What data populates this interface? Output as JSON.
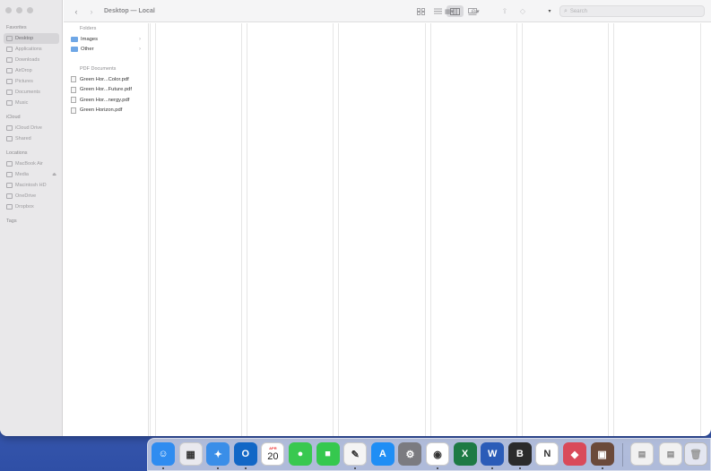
{
  "window": {
    "title": "Desktop — Local",
    "search_placeholder": "Search"
  },
  "sidebar": {
    "favorites_header": "Favorites",
    "favorites": [
      {
        "label": "Desktop",
        "icon": "desktop-icon",
        "active": true
      },
      {
        "label": "Applications",
        "icon": "applications-icon"
      },
      {
        "label": "Downloads",
        "icon": "downloads-icon"
      },
      {
        "label": "AirDrop",
        "icon": "airdrop-icon"
      },
      {
        "label": "Pictures",
        "icon": "pictures-icon"
      },
      {
        "label": "Documents",
        "icon": "documents-icon"
      },
      {
        "label": "Music",
        "icon": "music-icon"
      }
    ],
    "icloud_header": "iCloud",
    "icloud": [
      {
        "label": "iCloud Drive",
        "icon": "cloud-icon"
      },
      {
        "label": "Shared",
        "icon": "shared-folder-icon"
      }
    ],
    "locations_header": "Locations",
    "locations": [
      {
        "label": "MacBook Air",
        "icon": "laptop-icon"
      },
      {
        "label": "Media",
        "icon": "disk-icon",
        "eject": true
      },
      {
        "label": "Macintosh HD",
        "icon": "disk-icon"
      },
      {
        "label": "OneDrive",
        "icon": "folder-icon"
      },
      {
        "label": "Dropbox",
        "icon": "folder-icon"
      }
    ],
    "tags_header": "Tags"
  },
  "column1": {
    "folders_header": "Folders",
    "folders": [
      "Images",
      "Other"
    ],
    "pdf_header": "PDF Documents",
    "pdfs": [
      "Green Hor...Color.pdf",
      "Green Hor...Future.pdf",
      "Green Hor...nergy.pdf",
      "Green Horizon.pdf"
    ]
  },
  "dock": {
    "calendar_month": "APR",
    "calendar_day": "20",
    "apps": [
      {
        "name": "finder",
        "color": "#2f8cf0",
        "glyph": "☺",
        "running": true
      },
      {
        "name": "launchpad",
        "color": "#e9e9ee",
        "glyph": "▦",
        "running": false
      },
      {
        "name": "safari",
        "color": "#3a8ee8",
        "glyph": "✦",
        "running": true
      },
      {
        "name": "outlook",
        "color": "#1267c6",
        "glyph": "O",
        "running": true
      },
      {
        "name": "calendar",
        "color": "#ffffff",
        "glyph": "",
        "running": false
      },
      {
        "name": "messages",
        "color": "#39c850",
        "glyph": "●",
        "running": false
      },
      {
        "name": "facetime",
        "color": "#35c84e",
        "glyph": "■",
        "running": false
      },
      {
        "name": "textedit",
        "color": "#f4f4f4",
        "glyph": "✎",
        "running": true
      },
      {
        "name": "app-store",
        "color": "#1f8ef5",
        "glyph": "A",
        "running": false
      },
      {
        "name": "system-settings",
        "color": "#7b7b80",
        "glyph": "⚙",
        "running": false
      },
      {
        "name": "chrome",
        "color": "#ffffff",
        "glyph": "◉",
        "running": true
      },
      {
        "name": "excel",
        "color": "#1d7a44",
        "glyph": "X",
        "running": false
      },
      {
        "name": "word",
        "color": "#2b5cb8",
        "glyph": "W",
        "running": true
      },
      {
        "name": "bear",
        "color": "#2b2b2b",
        "glyph": "B",
        "running": true
      },
      {
        "name": "notion",
        "color": "#ffffff",
        "glyph": "N",
        "running": false
      },
      {
        "name": "shortcuts",
        "color": "#d94a5a",
        "glyph": "◆",
        "running": false
      },
      {
        "name": "app-brown",
        "color": "#6b4a3a",
        "glyph": "▣",
        "running": true
      }
    ],
    "docs": [
      {
        "name": "document-stack-1"
      },
      {
        "name": "document-stack-2"
      },
      {
        "name": "trash"
      }
    ]
  }
}
